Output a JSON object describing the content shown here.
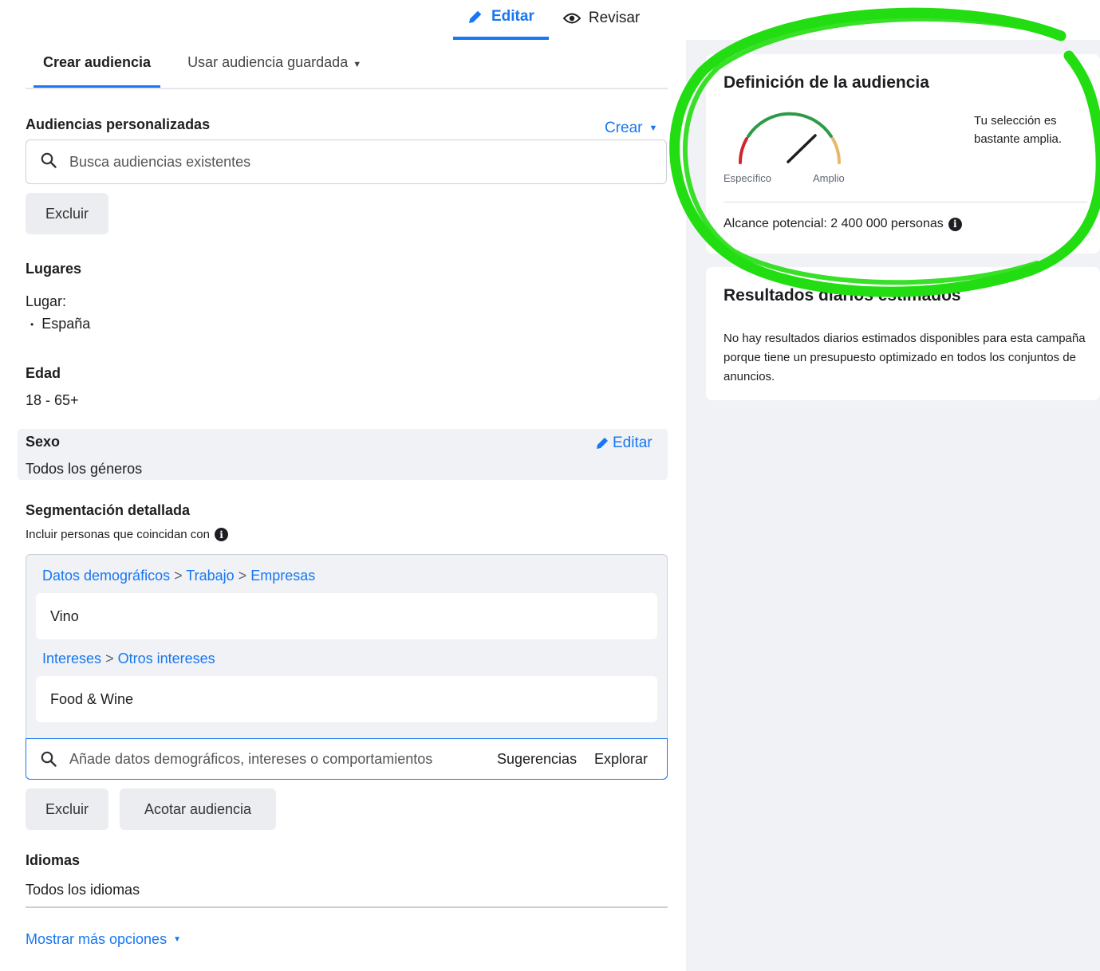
{
  "mode_tabs": {
    "edit_label": "Editar",
    "review_label": "Revisar"
  },
  "audience_tabs": {
    "create_label": "Crear audiencia",
    "saved_label": "Usar audiencia guardada"
  },
  "custom_audiences": {
    "title": "Audiencias personalizadas",
    "create_label": "Crear",
    "search_placeholder": "Busca audiencias existentes",
    "exclude_label": "Excluir"
  },
  "locations": {
    "title": "Lugares",
    "place_label": "Lugar:",
    "items": [
      "España"
    ]
  },
  "age": {
    "title": "Edad",
    "value": "18 - 65+"
  },
  "gender": {
    "title": "Sexo",
    "edit_label": "Editar",
    "value": "Todos los géneros"
  },
  "detailed_targeting": {
    "title": "Segmentación detallada",
    "subtitle": "Incluir personas que coincidan con",
    "groups": [
      {
        "path": [
          "Datos demográficos",
          "Trabajo",
          "Empresas"
        ],
        "item": "Vino"
      },
      {
        "path": [
          "Intereses",
          "Otros intereses"
        ],
        "item": "Food & Wine"
      }
    ],
    "search_placeholder": "Añade datos demográficos, intereses o comportamientos",
    "suggestions_label": "Sugerencias",
    "explore_label": "Explorar",
    "exclude_label": "Excluir",
    "narrow_label": "Acotar audiencia"
  },
  "languages": {
    "title": "Idiomas",
    "value": "Todos los idiomas"
  },
  "more_options_label": "Mostrar más opciones",
  "audience_definition": {
    "title": "Definición de la audiencia",
    "specific_label": "Específico",
    "broad_label": "Amplio",
    "breadth_text": "Tu selección es bastante amplia.",
    "reach_text": "Alcance potencial: 2 400 000 personas"
  },
  "daily_results": {
    "title": "Resultados diarios estimados",
    "description": "No hay resultados diarios estimados disponibles para esta campaña porque tiene un presupuesto optimizado en todos los conjuntos de anuncios."
  },
  "colors": {
    "accent": "#1877f2",
    "highlight": "#22dd11",
    "gauge_red": "#d0252c",
    "gauge_green": "#2e9a47",
    "gauge_yellow": "#e8b86a"
  }
}
